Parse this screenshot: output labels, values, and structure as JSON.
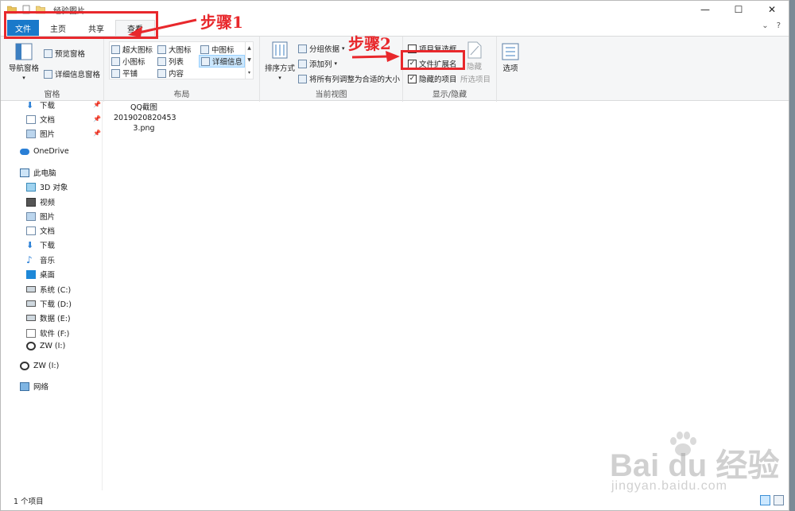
{
  "window": {
    "title": "经验图片",
    "controls": [
      "—",
      "☐",
      "✕"
    ]
  },
  "tabs": [
    {
      "label": "文件"
    },
    {
      "label": "主页"
    },
    {
      "label": "共享"
    },
    {
      "label": "查看"
    }
  ],
  "tabs_right": {
    "help": "?"
  },
  "ribbon": {
    "pane_group": {
      "label": "窗格",
      "nav_pane": "导航窗格",
      "preview_pane": "预览窗格",
      "details_pane": "详细信息窗格"
    },
    "layout_group": {
      "label": "布局",
      "items": [
        "超大图标",
        "大图标",
        "中图标",
        "小图标",
        "列表",
        "详细信息",
        "平铺",
        "内容"
      ]
    },
    "view_group": {
      "label": "当前视图",
      "sort": "排序方式",
      "group_by": "分组依据",
      "add_column": "添加列",
      "fit_columns": "将所有列调整为合适的大小"
    },
    "show_hide_group": {
      "label": "显示/隐藏",
      "item_checkboxes": "项目复选框",
      "file_extensions": "文件扩展名",
      "hidden_items": "隐藏的项目",
      "hide": "隐藏",
      "selected_items": "所选项目"
    },
    "options": "选项"
  },
  "nav": {
    "items": [
      {
        "label": "下载",
        "icon": "download-icon",
        "pinned": true
      },
      {
        "label": "文档",
        "icon": "document-icon",
        "pinned": true
      },
      {
        "label": "图片",
        "icon": "picture-icon",
        "pinned": true
      },
      {
        "label": "OneDrive",
        "icon": "cloud-icon"
      },
      {
        "label": "此电脑",
        "icon": "computer-icon"
      },
      {
        "label": "3D 对象",
        "icon": "cube-icon"
      },
      {
        "label": "视频",
        "icon": "video-icon"
      },
      {
        "label": "图片",
        "icon": "picture-icon"
      },
      {
        "label": "文档",
        "icon": "document-icon"
      },
      {
        "label": "下载",
        "icon": "download-icon"
      },
      {
        "label": "音乐",
        "icon": "music-icon"
      },
      {
        "label": "桌面",
        "icon": "desktop-icon"
      },
      {
        "label": "系统 (C:)",
        "icon": "drive-icon"
      },
      {
        "label": "下载 (D:)",
        "icon": "drive-icon"
      },
      {
        "label": "数据 (E:)",
        "icon": "drive-icon"
      },
      {
        "label": "软件 (F:)",
        "icon": "file-icon"
      },
      {
        "label": "ZW (I:)",
        "icon": "disc-icon"
      },
      {
        "label": "ZW (I:)",
        "icon": "disc-icon"
      },
      {
        "label": "网络",
        "icon": "network-icon"
      }
    ]
  },
  "content": {
    "file": {
      "line1": "QQ截图",
      "line2": "2019020820453",
      "line3": "3.png"
    }
  },
  "status": {
    "text": "1 个项目"
  },
  "annotations": {
    "step1": "步骤1",
    "step2": "步骤2"
  },
  "watermark": {
    "main": "Bai du 经验",
    "sub": "jingyan.baidu.com"
  },
  "colors": {
    "accent": "#1979ca",
    "annotation": "#e8282c",
    "ribbon_bg": "#f5f6f7"
  }
}
